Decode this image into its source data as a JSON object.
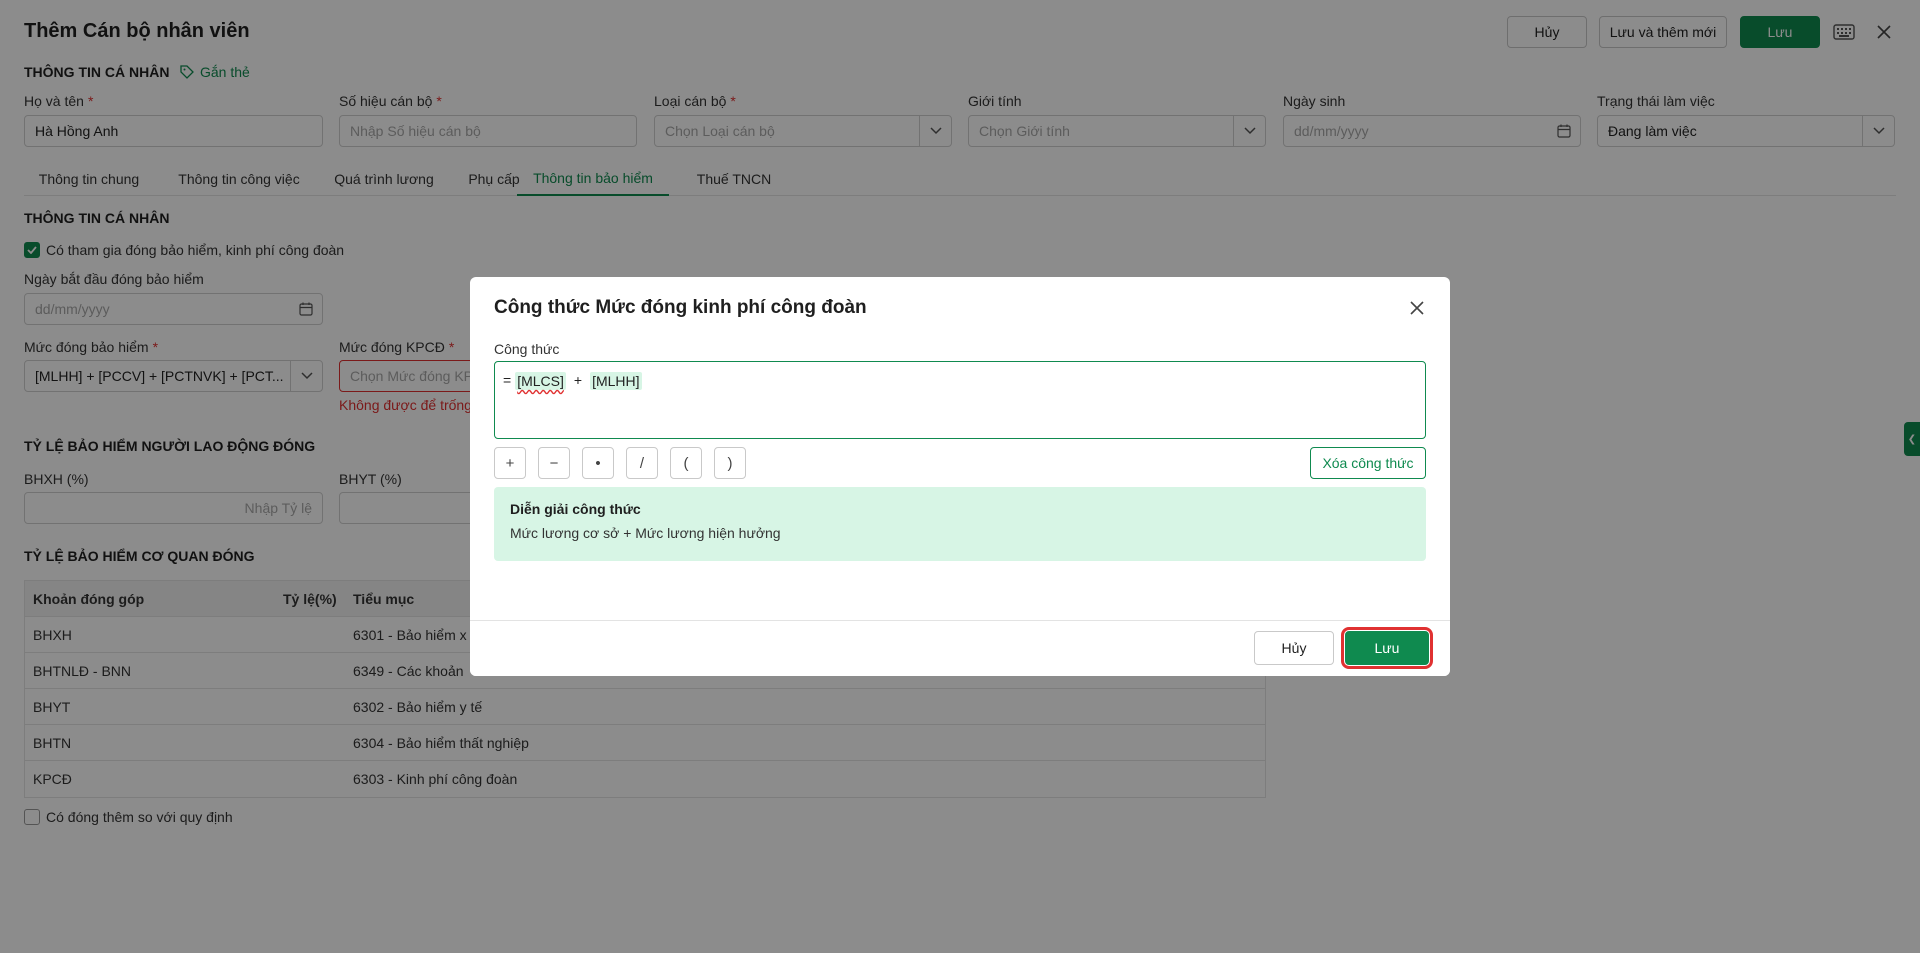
{
  "header": {
    "title": "Thêm Cán bộ nhân viên",
    "cancel_label": "Hủy",
    "save_new_label": "Lưu và thêm mới",
    "save_label": "Lưu"
  },
  "personal": {
    "section_title": "THÔNG TIN CÁ NHÂN",
    "tag_label": "Gắn thẻ",
    "fields": {
      "name": {
        "label": "Họ và tên",
        "required": "*",
        "value": "Hà Hồng Anh"
      },
      "code": {
        "label": "Số hiệu cán bộ",
        "required": "*",
        "placeholder": "Nhập Số hiệu cán bộ"
      },
      "type": {
        "label": "Loại cán bộ",
        "required": "*",
        "placeholder": "Chọn Loại cán bộ"
      },
      "gender": {
        "label": "Giới tính",
        "placeholder": "Chọn Giới tính"
      },
      "dob": {
        "label": "Ngày sinh",
        "placeholder": "dd/mm/yyyy"
      },
      "status": {
        "label": "Trạng thái làm việc",
        "value": "Đang làm việc"
      }
    }
  },
  "tabs": [
    {
      "label": "Thông tin chung"
    },
    {
      "label": "Thông tin công việc"
    },
    {
      "label": "Quá trình lương"
    },
    {
      "label": "Phụ cấp"
    },
    {
      "label": "Thông tin bảo hiểm",
      "active": true
    },
    {
      "label": "Thuế TNCN"
    }
  ],
  "insurance": {
    "section_title": "THÔNG TIN CÁ NHÂN",
    "participate_label": "Có tham gia đóng bảo hiểm, kinh phí công đoàn",
    "start_date_label": "Ngày bắt đầu đóng bảo hiểm",
    "start_date_placeholder": "dd/mm/yyyy",
    "level_label": "Mức đóng bảo hiểm",
    "level_required": "*",
    "level_value": "[MLHH] + [PCCV] + [PCTNVK] + [PCT...",
    "kpcd_label": "Mức đóng KPCĐ",
    "kpcd_required": "*",
    "kpcd_placeholder": "Chọn Mức đóng KPC",
    "kpcd_error": "Không được để trống",
    "employee_section": "TỶ LỆ BẢO HIỂM NGƯỜI LAO ĐỘNG ĐÓNG",
    "bhxh_label": "BHXH (%)",
    "bhxh_placeholder": "Nhập Tỷ lệ",
    "bhyt_label": "BHYT (%)",
    "agency_section": "TỶ LỆ BẢO HIỂM CƠ QUAN ĐÓNG",
    "table": {
      "headers": [
        "Khoản đóng góp",
        "Tỷ lệ(%)",
        "Tiểu mục"
      ],
      "rows": [
        [
          "BHXH",
          "",
          "6301 - Bảo hiểm x"
        ],
        [
          "BHTNLĐ - BNN",
          "",
          "6349 - Các khoản"
        ],
        [
          "BHYT",
          "",
          "6302 - Bảo hiểm y tế"
        ],
        [
          "BHTN",
          "",
          "6304 - Bảo hiểm thất nghiệp"
        ],
        [
          "KPCĐ",
          "",
          "6303 - Kinh phí công đoàn"
        ]
      ]
    },
    "extra_label": "Có đóng thêm so với quy định"
  },
  "modal": {
    "title": "Công thức Mức đóng kinh phí công đoàn",
    "formula_label": "Công thức",
    "formula": {
      "prefix": "=",
      "token1": "[MLCS]",
      "operator": "+",
      "token2": "[MLHH]"
    },
    "ops": [
      "+",
      "−",
      "•",
      "/",
      "(",
      ")"
    ],
    "clear_label": "Xóa công thức",
    "explain_title": "Diễn giải công thức",
    "explain_text": "Mức lương cơ sở + Mức lương hiện hưởng",
    "cancel_label": "Hủy",
    "save_label": "Lưu"
  },
  "colors": {
    "primary": "#0f8a4f",
    "error": "#e03131",
    "highlight": "#d7f5e5"
  }
}
